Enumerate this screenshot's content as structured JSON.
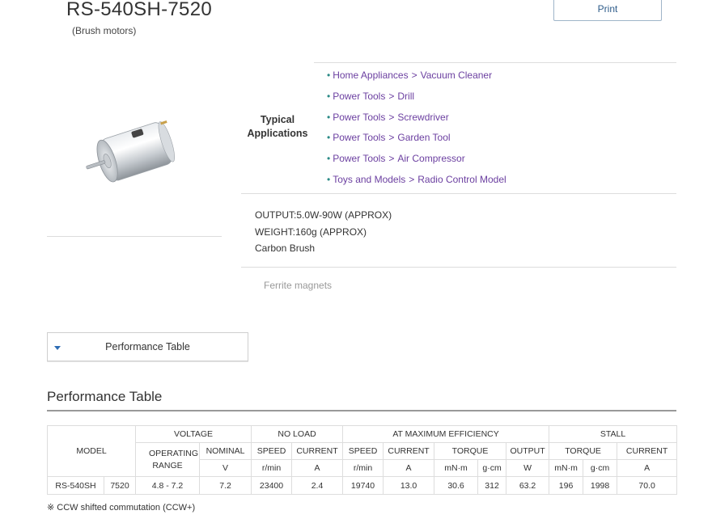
{
  "product": {
    "title": "RS-540SH-7520",
    "subtitle": "(Brush motors)"
  },
  "print_label": "Print",
  "applications": {
    "label_line1": "Typical",
    "label_line2": "Applications",
    "items": [
      {
        "category": "Home Appliances",
        "separator": ">",
        "item": "Vacuum Cleaner"
      },
      {
        "category": "Power Tools",
        "separator": ">",
        "item": "Drill"
      },
      {
        "category": "Power Tools",
        "separator": ">",
        "item": "Screwdriver"
      },
      {
        "category": "Power Tools",
        "separator": ">",
        "item": "Garden Tool"
      },
      {
        "category": "Power Tools",
        "separator": ">",
        "item": "Air Compressor"
      },
      {
        "category": "Toys and Models",
        "separator": ">",
        "item": "Radio Control Model"
      }
    ],
    "bullet": "•"
  },
  "specs": {
    "output": "OUTPUT:5.0W-90W (APPROX)",
    "weight": "WEIGHT:160g (APPROX)",
    "brush": "Carbon Brush",
    "magnets": "Ferrite magnets"
  },
  "perf_tab_label": "Performance Table",
  "perf_heading": "Performance Table",
  "table": {
    "model_header": "MODEL",
    "voltage": "VOLTAGE",
    "operating_range": "OPERATING RANGE",
    "nominal": "NOMINAL",
    "no_load": "NO LOAD",
    "at_max_eff": "AT MAXIMUM EFFICIENCY",
    "stall": "STALL",
    "speed": "SPEED",
    "current": "CURRENT",
    "torque": "TORQUE",
    "output": "OUTPUT",
    "units": {
      "nominal": "V",
      "nl_speed": "r/min",
      "nl_current": "A",
      "me_speed": "r/min",
      "me_current": "A",
      "me_torque_mn": "mN·m",
      "me_torque_g": "g·cm",
      "me_output": "W",
      "st_torque_mn": "mN·m",
      "st_torque_g": "g·cm",
      "st_current": "A"
    },
    "row": {
      "model": "RS-540SH",
      "variant": "7520",
      "operating_range": "4.8 - 7.2",
      "nominal": "7.2",
      "nl_speed": "23400",
      "nl_current": "2.4",
      "me_speed": "19740",
      "me_current": "13.0",
      "me_torque_mn": "30.6",
      "me_torque_g": "312",
      "me_output": "63.2",
      "st_torque_mn": "196",
      "st_torque_g": "1998",
      "st_current": "70.0"
    }
  },
  "note": "※ CCW shifted commutation (CCW+)",
  "icons": {
    "perf_tab": "triangle-down-icon"
  },
  "colors": {
    "link": "#6b3fa0",
    "bullet": "#2a8a86",
    "accent": "#2e6db4"
  }
}
